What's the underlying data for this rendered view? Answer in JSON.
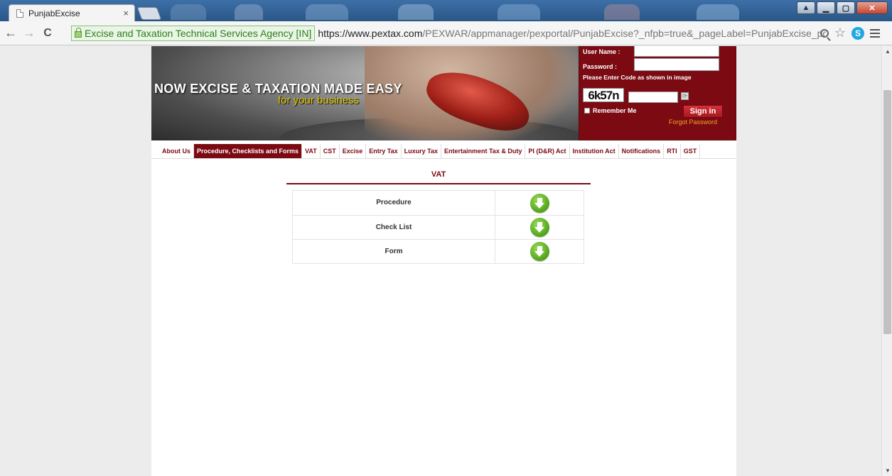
{
  "browser": {
    "tab_title": "PunjabExcise",
    "tab_close": "×",
    "ev_label": "Excise and Taxation Technical Services Agency [IN]",
    "url_host": "https://www.pextax.com",
    "url_path": "/PEXWAR/appmanager/pexportal/PunjabExcise?_nfpb=true&_pageLabel=PunjabExcise_pc",
    "icons": [
      "back-arrow-icon",
      "forward-arrow-icon",
      "reload-icon",
      "lock-icon",
      "zoom-icon",
      "star-icon",
      "skype-icon",
      "menu-icon"
    ]
  },
  "banner": {
    "title": "NOW EXCISE & TAXATION MADE EASY",
    "subtitle": "for your business"
  },
  "login": {
    "username_label": "User Name :",
    "password_label": "Password :",
    "captcha_note": "Please Enter Code as shown in image",
    "captcha_code": "6k57n",
    "remember_label": "Remember Me",
    "signin_label": "Sign in",
    "forgot_label": "Forgot Password"
  },
  "nav": {
    "items": [
      {
        "label": "About Us"
      },
      {
        "label": "Procedure, Checklists and Forms"
      },
      {
        "label": "VAT"
      },
      {
        "label": "CST"
      },
      {
        "label": "Excise"
      },
      {
        "label": "Entry Tax"
      },
      {
        "label": "Luxury Tax"
      },
      {
        "label": "Entertainment Tax & Duty"
      },
      {
        "label": "PI (D&R) Act"
      },
      {
        "label": "Institution Act"
      },
      {
        "label": "Notifications"
      },
      {
        "label": "RTI"
      },
      {
        "label": "GST"
      }
    ],
    "active": "Procedure, Checklists and Forms"
  },
  "content": {
    "section_title": "VAT",
    "rows": [
      {
        "label": "Procedure",
        "action_icon": "download-icon"
      },
      {
        "label": "Check List",
        "action_icon": "download-icon"
      },
      {
        "label": "Form",
        "action_icon": "download-icon"
      }
    ]
  },
  "colors": {
    "brand_maroon": "#7b0a12",
    "signin_red": "#c0222a",
    "forgot_orange": "#f5a623",
    "download_green": "#5aaa22",
    "banner_yellow": "#e0c600"
  }
}
